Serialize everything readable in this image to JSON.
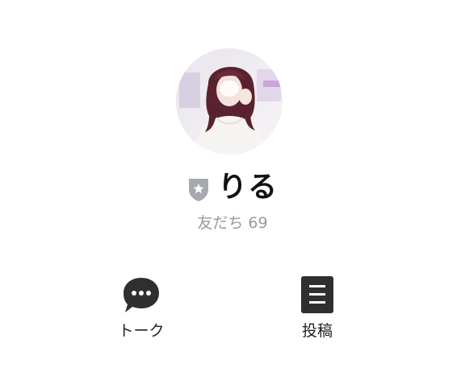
{
  "profile": {
    "name": "りる",
    "friends_label": "友だち 69",
    "badge_icon": "shield-star-icon",
    "avatar_icon": "profile-photo"
  },
  "actions": [
    {
      "label": "トーク",
      "icon": "chat-bubble-icon"
    },
    {
      "label": "投稿",
      "icon": "post-icon"
    }
  ],
  "colors": {
    "text_primary": "#111111",
    "text_secondary": "#9a9a9a",
    "icon_dark": "#2f2f2f",
    "badge_gray": "#a6a9ad"
  }
}
